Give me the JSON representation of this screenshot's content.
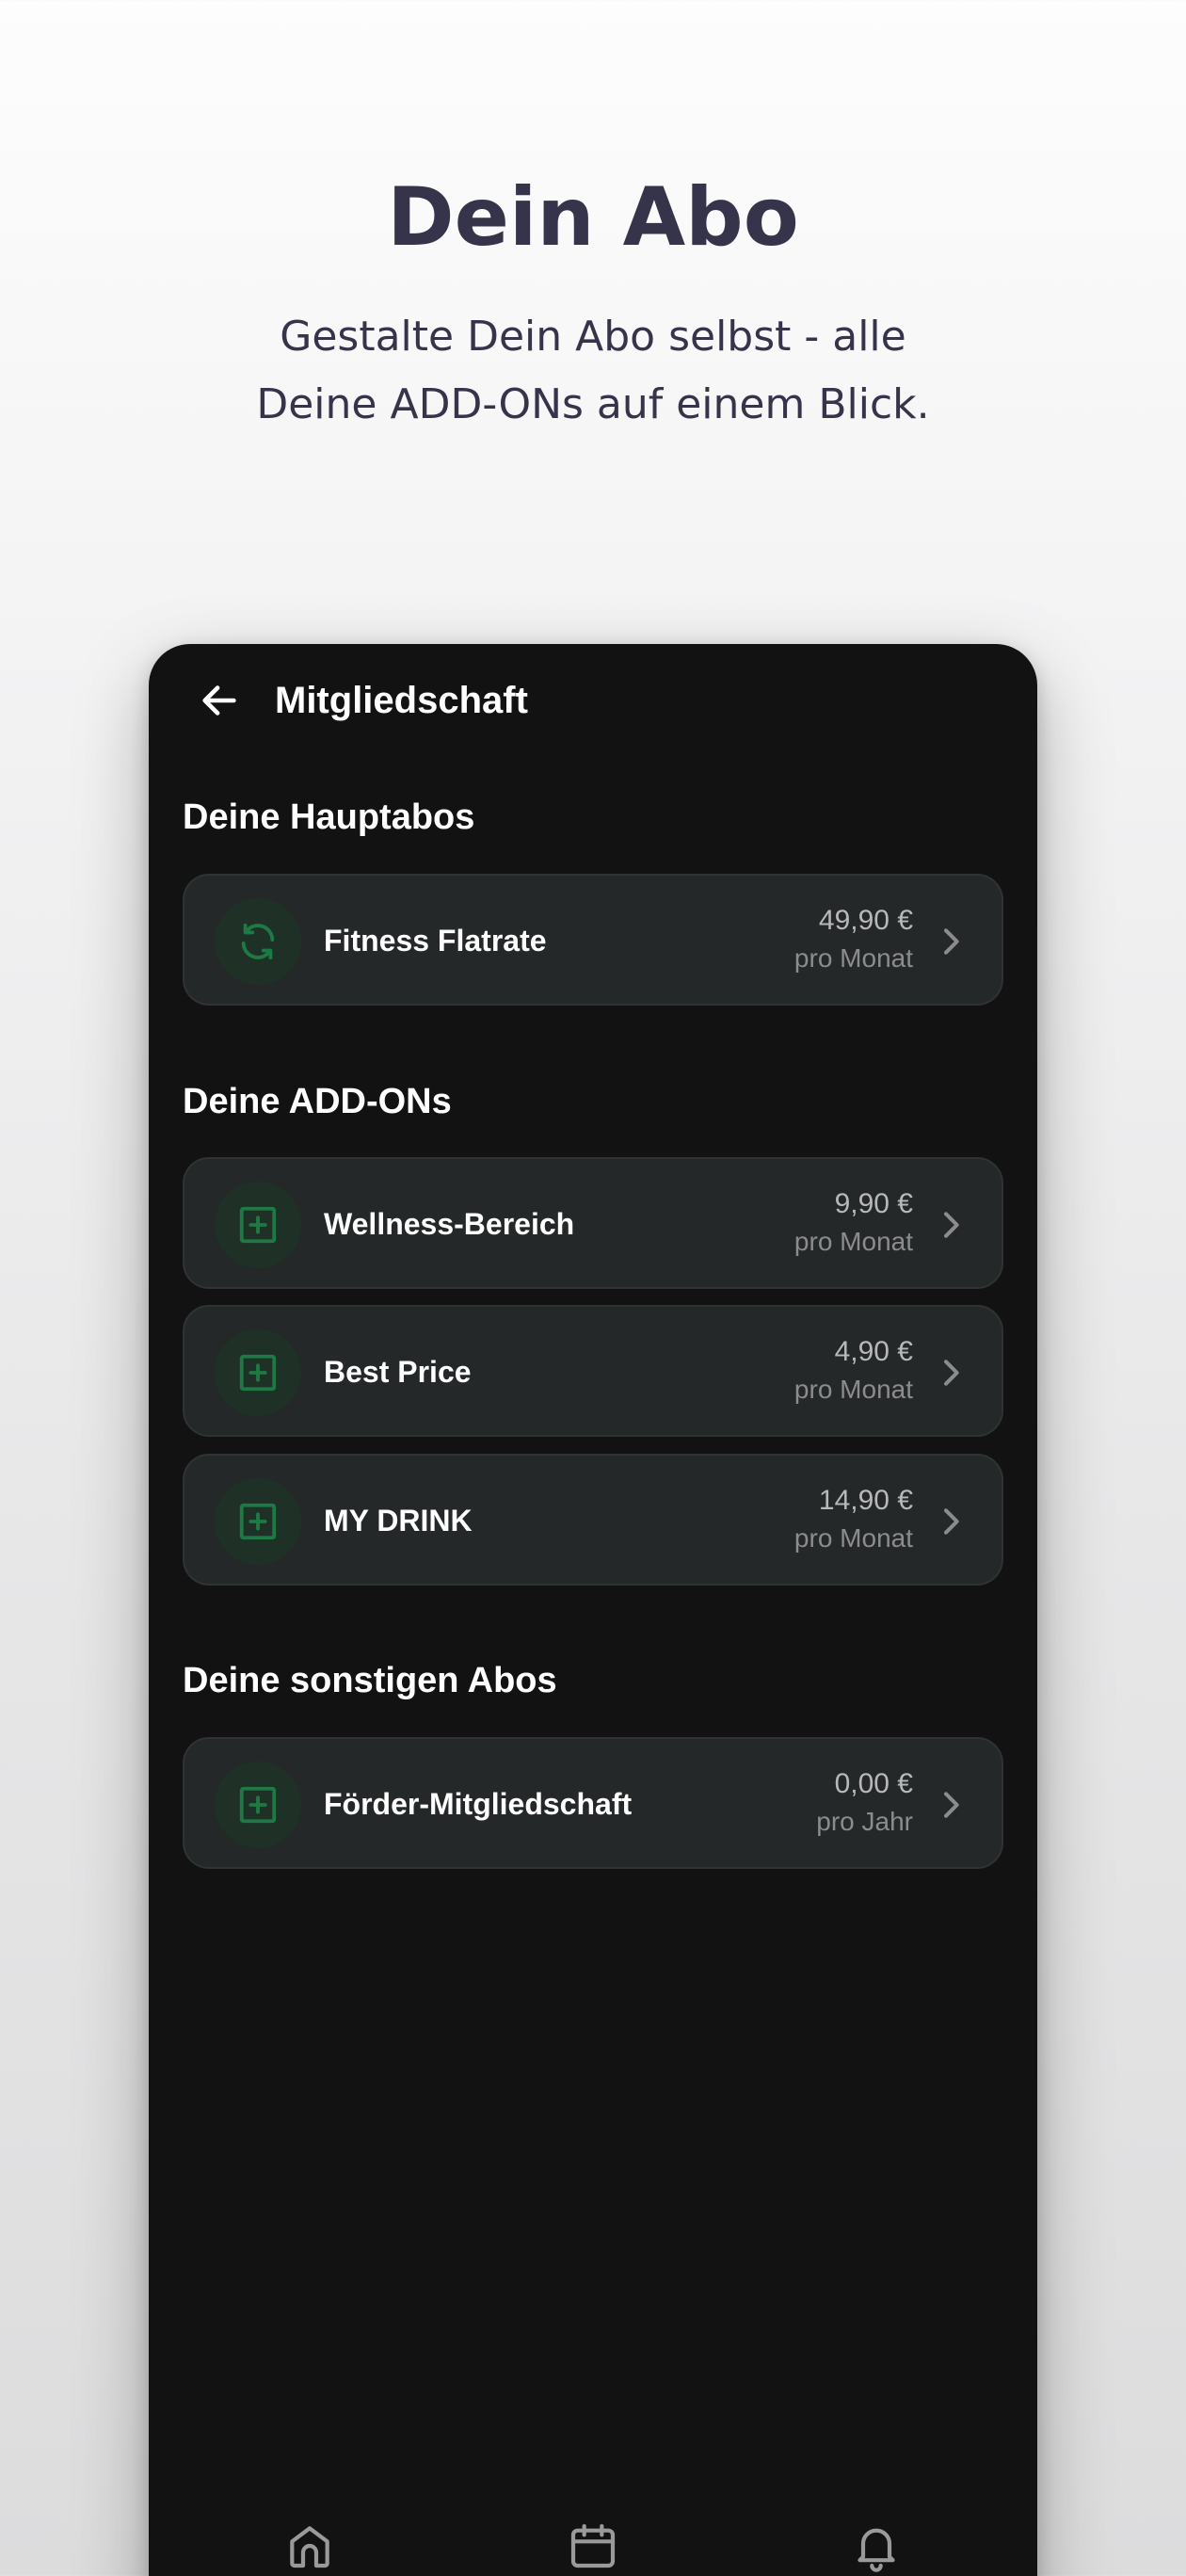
{
  "promo": {
    "title": "Dein Abo",
    "subtitle_line1": "Gestalte Dein Abo selbst - alle",
    "subtitle_line2": "Deine ADD-ONs auf einem Blick."
  },
  "appbar": {
    "title": "Mitgliedschaft",
    "back_icon": "arrow-left-icon"
  },
  "sections": {
    "main": {
      "title": "Deine Hauptabos",
      "items": [
        {
          "name": "Fitness Flatrate",
          "price": "49,90 €",
          "period": "pro Monat",
          "icon": "refresh-icon"
        }
      ]
    },
    "addons": {
      "title": "Deine ADD-ONs",
      "items": [
        {
          "name": "Wellness-Bereich",
          "price": "9,90 €",
          "period": "pro Monat",
          "icon": "plus-square-icon"
        },
        {
          "name": "Best Price",
          "price": "4,90 €",
          "period": "pro Monat",
          "icon": "plus-square-icon"
        },
        {
          "name": "MY DRINK",
          "price": "14,90 €",
          "period": "pro Monat",
          "icon": "plus-square-icon"
        }
      ]
    },
    "other": {
      "title": "Deine sonstigen Abos",
      "items": [
        {
          "name": "Förder-Mitgliedschaft",
          "price": "0,00 €",
          "period": "pro Jahr",
          "icon": "plus-square-icon"
        }
      ]
    }
  },
  "bottom_nav": {
    "icons": [
      "home-icon",
      "calendar-icon",
      "bell-icon"
    ]
  },
  "colors": {
    "accent_green": "#1e7a45",
    "card_bg": "#242828",
    "screen_bg": "#121212",
    "promo_text": "#35344a"
  }
}
